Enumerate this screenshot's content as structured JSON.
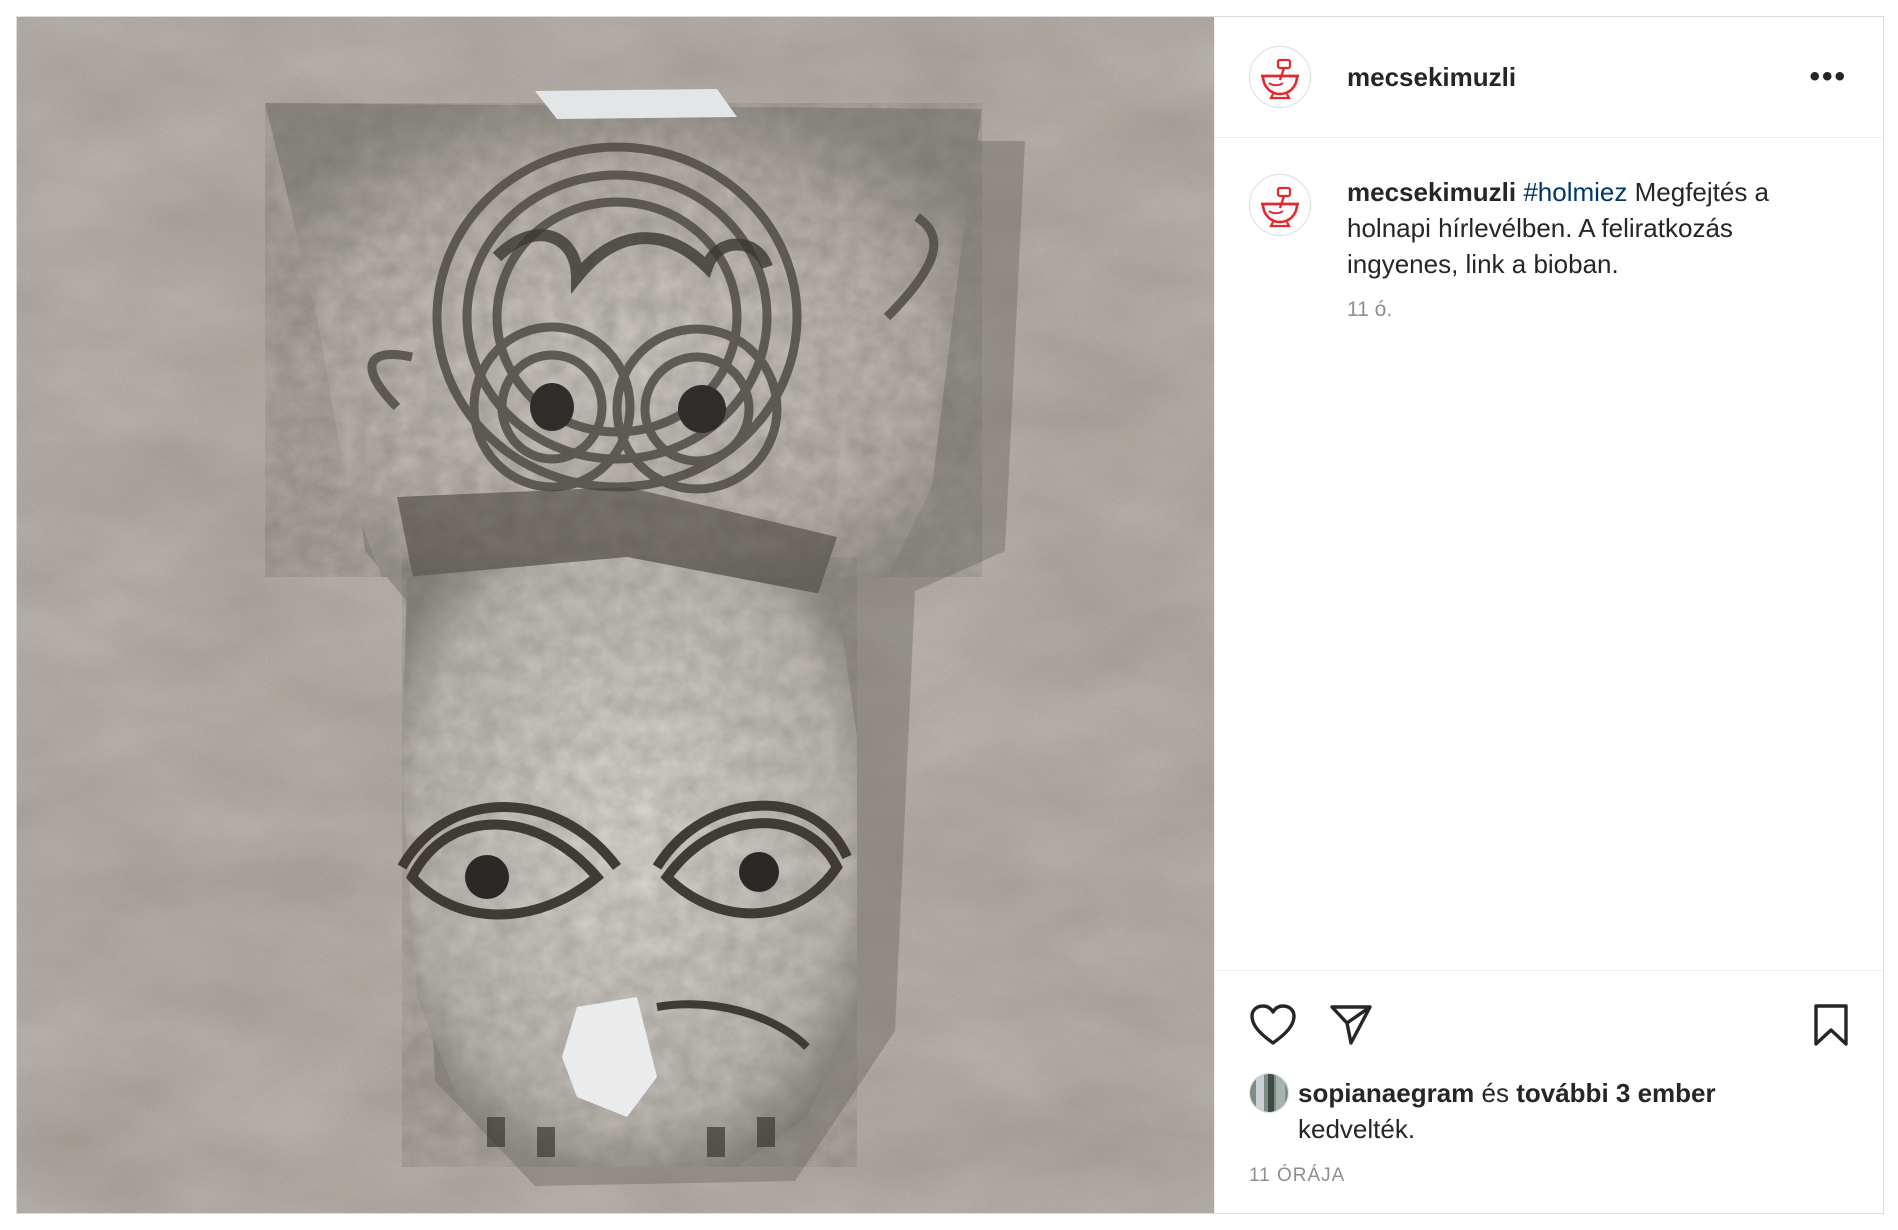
{
  "header": {
    "username": "mecsekimuzli",
    "more_label": "•••"
  },
  "caption": {
    "username": "mecsekimuzli",
    "hashtag": "#holmiez",
    "text": " Megfejtés a holnapi hírlevélben. A feliratkozás ingyenes, link a bioban.",
    "time": "11 ó."
  },
  "likes": {
    "first_user": "sopianaegram",
    "connector": " és ",
    "others": "további 3 ember",
    "suffix": " kedvelték."
  },
  "timestamp": "11 ÓRÁJA",
  "icons": {
    "avatar": "soup-bowl-logo-icon",
    "like": "heart-icon",
    "share": "paper-plane-icon",
    "save": "bookmark-icon",
    "more": "more-options-icon"
  },
  "colors": {
    "brand_red": "#e0282e",
    "hashtag": "#00376b",
    "text": "#262626",
    "muted": "#8e8e8e",
    "border": "#dbdbdb"
  },
  "media": {
    "description": "Carved stone capital with a face on a travertine wall"
  }
}
